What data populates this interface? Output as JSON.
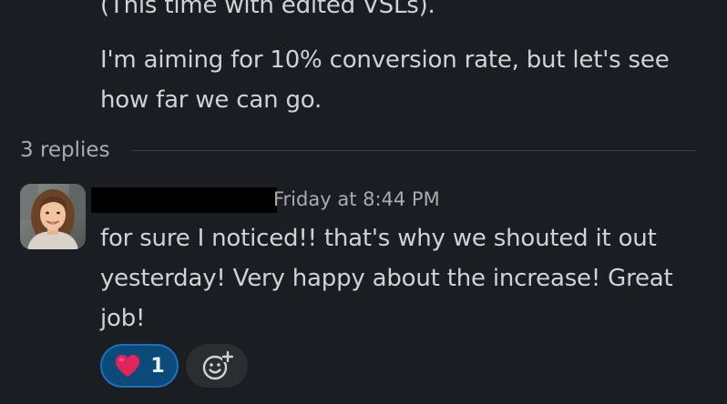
{
  "parent_message": {
    "lines": [
      "(This time with edited VSLs).",
      "I'm aiming for 10% conversion rate, but let's see",
      "how far we can go."
    ]
  },
  "thread": {
    "replies_label": "3 replies"
  },
  "reply": {
    "timestamp": "Friday at 8:44 PM",
    "lines": [
      "for sure I noticed!! that's why we shouted it out",
      "yesterday! Very happy about the increase! Great",
      "job!"
    ],
    "reactions": [
      {
        "emoji": "heart",
        "count": "1"
      }
    ],
    "add_reaction_icon": "add-emoji-icon"
  },
  "colors": {
    "background": "#1a1d21",
    "text": "#d1d2d3",
    "muted_text": "#ababad",
    "reaction_active_bg": "#0b4a79",
    "reaction_active_border": "#1d71b8",
    "heart": "#e0245e"
  }
}
